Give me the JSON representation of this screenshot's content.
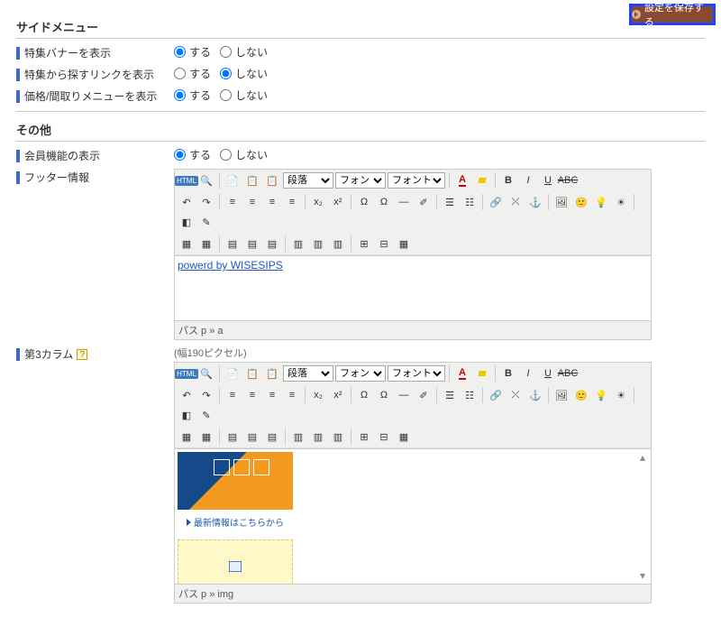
{
  "save_button": "設定を保存する",
  "sections": {
    "sidemenu": {
      "title": "サイドメニュー",
      "rows": {
        "banner": {
          "label": "特集バナーを表示",
          "opt_yes": "する",
          "opt_no": "しない",
          "value": "yes"
        },
        "searchlink": {
          "label": "特集から探すリンクを表示",
          "opt_yes": "する",
          "opt_no": "しない",
          "value": "no"
        },
        "price_plan": {
          "label": "価格/間取りメニューを表示",
          "opt_yes": "する",
          "opt_no": "しない",
          "value": "yes"
        }
      }
    },
    "other": {
      "title": "その他",
      "member": {
        "label": "会員機能の表示",
        "opt_yes": "する",
        "opt_no": "しない",
        "value": "yes"
      },
      "footer": {
        "label": "フッター情報"
      },
      "col3": {
        "label": "第3カラム",
        "hint": "(幅190ピクセル)"
      }
    }
  },
  "editor1": {
    "dropdowns": {
      "format": "段落",
      "font": "フォント",
      "size": "フォントの大き"
    },
    "content_link": "powerd by WISESIPS",
    "status": "パス  p » a"
  },
  "editor2": {
    "dropdowns": {
      "format": "段落",
      "font": "フォント",
      "size": "フォントの大き"
    },
    "banner_text": "最新情報はこちらから",
    "status": "パス  p » img"
  }
}
